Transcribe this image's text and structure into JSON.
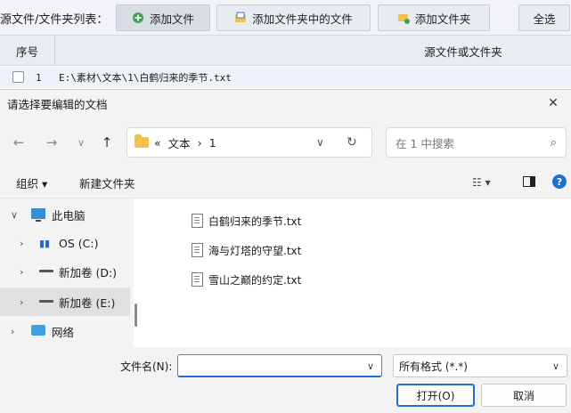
{
  "app": {
    "list_label": "源文件/文件夹列表：",
    "buttons": {
      "add_file": "添加文件",
      "add_folder_files": "添加文件夹中的文件",
      "add_folder": "添加文件夹",
      "select_all": "全选"
    },
    "table": {
      "col_index": "序号",
      "col_source": "源文件或文件夹",
      "rows": [
        {
          "index": "1",
          "path": "E:\\素材\\文本\\1\\白鹤归来的季节.txt"
        }
      ]
    }
  },
  "dialog": {
    "title": "请选择要编辑的文档",
    "close_glyph": "✕",
    "nav": {
      "back": "←",
      "forward": "→",
      "recent": "∨",
      "up": "↑"
    },
    "address": {
      "prefix": "«",
      "crumb1": "文本",
      "sep": "›",
      "crumb2": "1",
      "dropdown": "∨",
      "refresh": "↻"
    },
    "search_placeholder": "在 1 中搜索",
    "search_icon": "⌕",
    "commands": {
      "organize": "组织 ▾",
      "new_folder": "新建文件夹",
      "view": "☷ ▾",
      "help": "?"
    },
    "tree": [
      {
        "label": "此电脑",
        "chevron": "∨",
        "icon": "pc-icon"
      },
      {
        "label": "OS (C:)",
        "chevron": "›",
        "icon": "os-drive-icon"
      },
      {
        "label": "新加卷 (D:)",
        "chevron": "›",
        "icon": "drive-icon"
      },
      {
        "label": "新加卷 (E:)",
        "chevron": "›",
        "icon": "drive-icon",
        "selected": true
      },
      {
        "label": "网络",
        "chevron": "›",
        "icon": "network-icon"
      }
    ],
    "files": [
      {
        "name": "白鹤归来的季节.txt"
      },
      {
        "name": "海与灯塔的守望.txt"
      },
      {
        "name": "雪山之巅的约定.txt"
      }
    ],
    "filename_label": "文件名(N):",
    "filename_value": "",
    "filetype_value": "所有格式 (*.*)",
    "open_label": "打开(O)",
    "cancel_label": "取消",
    "dropdown_glyph": "∨"
  },
  "colors": {
    "accent": "#1f6fd1",
    "folder": "#f2c14e",
    "add_icon": "#3fa34d"
  }
}
